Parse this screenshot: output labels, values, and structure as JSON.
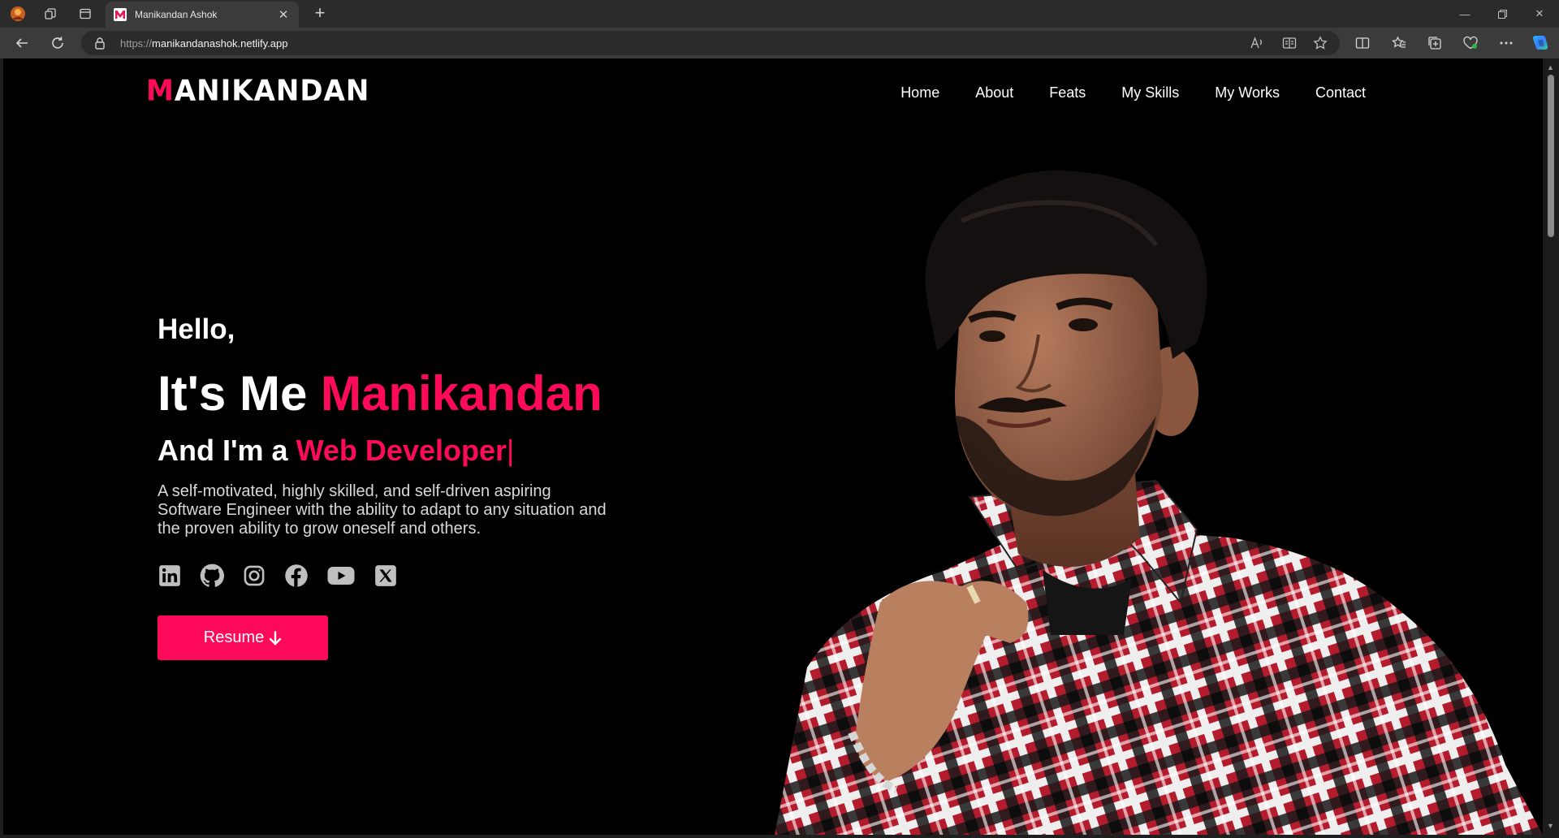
{
  "browser": {
    "tab_title": "Manikandan Ashok",
    "url_prefix": "https://",
    "url_host": "manikandanashok.netlify.app"
  },
  "site": {
    "logo_first": "M",
    "logo_rest": "ANIKANDAN",
    "nav": [
      "Home",
      "About",
      "Feats",
      "My Skills",
      "My Works",
      "Contact"
    ]
  },
  "hero": {
    "greeting": "Hello,",
    "intro_prefix": "It's Me ",
    "name": "Manikandan",
    "role_prefix": "And I'm a ",
    "role": "Web Developer",
    "caret": "|",
    "description": "A self-motivated, highly skilled, and self-driven aspiring Software Engineer with the ability to adapt to any situation and the proven ability to grow oneself and others.",
    "resume_label": "Resume",
    "resume_icon": "arrow-down-icon"
  },
  "socials": [
    "linkedin-icon",
    "github-icon",
    "instagram-icon",
    "facebook-icon",
    "youtube-icon",
    "x-icon"
  ],
  "colors": {
    "accent": "#ff0a5a",
    "background": "#000000",
    "text": "#ffffff"
  }
}
